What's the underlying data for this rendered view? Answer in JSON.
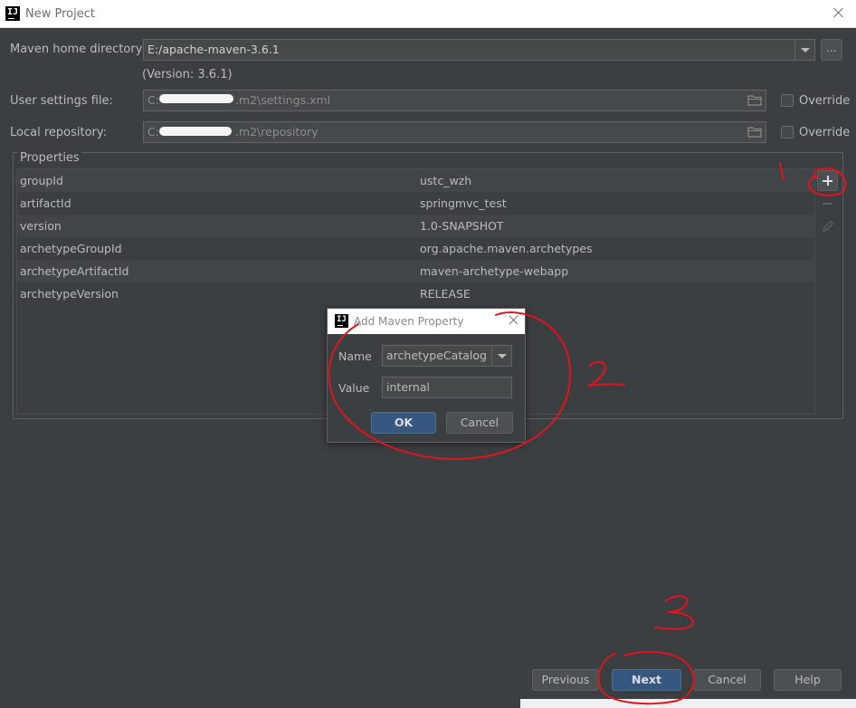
{
  "window": {
    "title": "New Project"
  },
  "form": {
    "maven_home": {
      "label": "Maven home directory:",
      "value": "E:/apache-maven-3.6.1",
      "version": "(Version: 3.6.1)",
      "browse_label": "..."
    },
    "user_settings": {
      "label": "User settings file:",
      "value_prefix": "C:",
      "value_suffix": ".m2\\settings.xml",
      "override_label": "Override",
      "override_checked": false
    },
    "local_repository": {
      "label": "Local repository:",
      "value_prefix": "C:",
      "value_suffix": ".m2\\repository",
      "override_label": "Override",
      "override_checked": false
    }
  },
  "properties": {
    "title": "Properties",
    "rows": [
      {
        "key": "groupId",
        "value": "ustc_wzh"
      },
      {
        "key": "artifactId",
        "value": "springmvc_test"
      },
      {
        "key": "version",
        "value": "1.0-SNAPSHOT"
      },
      {
        "key": "archetypeGroupId",
        "value": "org.apache.maven.archetypes"
      },
      {
        "key": "archetypeArtifactId",
        "value": "maven-archetype-webapp"
      },
      {
        "key": "archetypeVersion",
        "value": "RELEASE"
      }
    ],
    "toolbar_icons": [
      "add-icon",
      "remove-icon",
      "edit-icon"
    ]
  },
  "dialog": {
    "title": "Add Maven Property",
    "name_label": "Name",
    "name_value": "archetypeCatalog",
    "value_label": "Value",
    "value_value": "internal",
    "ok_label": "OK",
    "cancel_label": "Cancel"
  },
  "buttons": {
    "previous": "Previous",
    "next": "Next",
    "cancel": "Cancel",
    "help": "Help"
  },
  "annotations": {
    "color": "#e0141e",
    "marks": [
      "1",
      "2",
      "3"
    ]
  },
  "colors": {
    "background": "#3c3f41",
    "primary_button": "#365880",
    "field": "#45494a"
  }
}
